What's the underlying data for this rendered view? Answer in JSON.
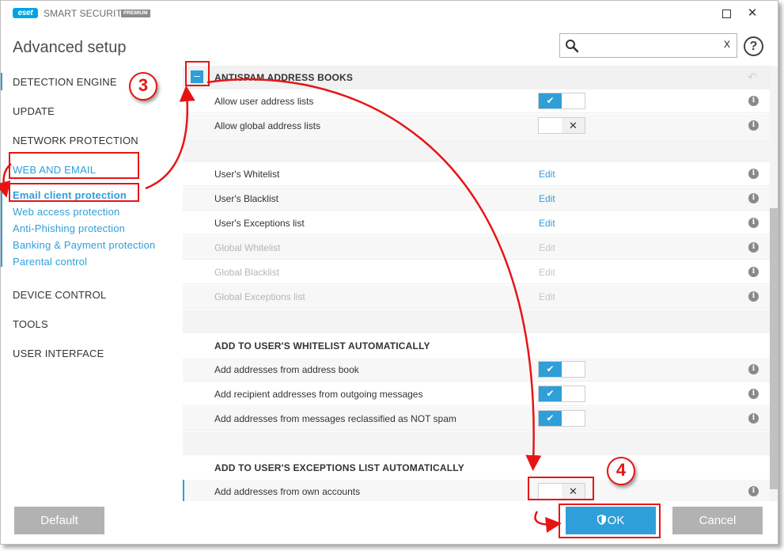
{
  "titlebar": {
    "logo": "eset",
    "product": "SMART SECURITY",
    "badge": "PREMIUM",
    "maximize_icon": "maximize-icon",
    "close_symbol": "✕"
  },
  "header": {
    "title": "Advanced setup",
    "search": {
      "value": "",
      "placeholder": "",
      "clear_symbol": "x"
    },
    "help_symbol": "?"
  },
  "sidebar": {
    "items": [
      {
        "label": "DETECTION ENGINE"
      },
      {
        "label": "UPDATE"
      },
      {
        "label": "NETWORK PROTECTION"
      },
      {
        "label": "WEB AND EMAIL",
        "active": true
      },
      {
        "label": "DEVICE CONTROL"
      },
      {
        "label": "TOOLS"
      },
      {
        "label": "USER INTERFACE"
      }
    ],
    "sub_items": [
      {
        "label": "Email client protection",
        "selected": true
      },
      {
        "label": "Web access protection"
      },
      {
        "label": "Anti-Phishing protection"
      },
      {
        "label": "Banking & Payment protection"
      },
      {
        "label": "Parental control"
      }
    ]
  },
  "main": {
    "section_antispam": {
      "title": "ANTISPAM ADDRESS BOOKS",
      "collapse_symbol": "–",
      "rows": [
        {
          "label": "Allow user address lists",
          "toggle": "on"
        },
        {
          "label": "Allow global address lists",
          "toggle": "off"
        }
      ]
    },
    "address_lists": [
      {
        "label": "User's Whitelist",
        "action": "Edit",
        "enabled": true
      },
      {
        "label": "User's Blacklist",
        "action": "Edit",
        "enabled": true
      },
      {
        "label": "User's Exceptions list",
        "action": "Edit",
        "enabled": true
      },
      {
        "label": "Global Whitelist",
        "action": "Edit",
        "enabled": false
      },
      {
        "label": "Global Blacklist",
        "action": "Edit",
        "enabled": false
      },
      {
        "label": "Global Exceptions list",
        "action": "Edit",
        "enabled": false
      }
    ],
    "section_whitelist_auto": {
      "title": "ADD TO USER'S WHITELIST AUTOMATICALLY",
      "rows": [
        {
          "label": "Add addresses from address book",
          "toggle": "on"
        },
        {
          "label": "Add recipient addresses from outgoing messages",
          "toggle": "on"
        },
        {
          "label": "Add addresses from messages reclassified as NOT spam",
          "toggle": "on"
        }
      ]
    },
    "section_exceptions_auto": {
      "title": "ADD TO USER'S EXCEPTIONS LIST AUTOMATICALLY",
      "rows": [
        {
          "label": "Add addresses from own accounts",
          "toggle": "off"
        }
      ]
    },
    "info_symbol": "i",
    "check_symbol": "✔",
    "cross_symbol": "✕"
  },
  "footer": {
    "default_label": "Default",
    "ok_label": "OK",
    "cancel_label": "Cancel"
  },
  "annotations": {
    "step3": "3",
    "step4": "4",
    "color": "#e81414"
  },
  "colors": {
    "accent": "#2e9fd9",
    "button_gray": "#b2b2b2"
  }
}
